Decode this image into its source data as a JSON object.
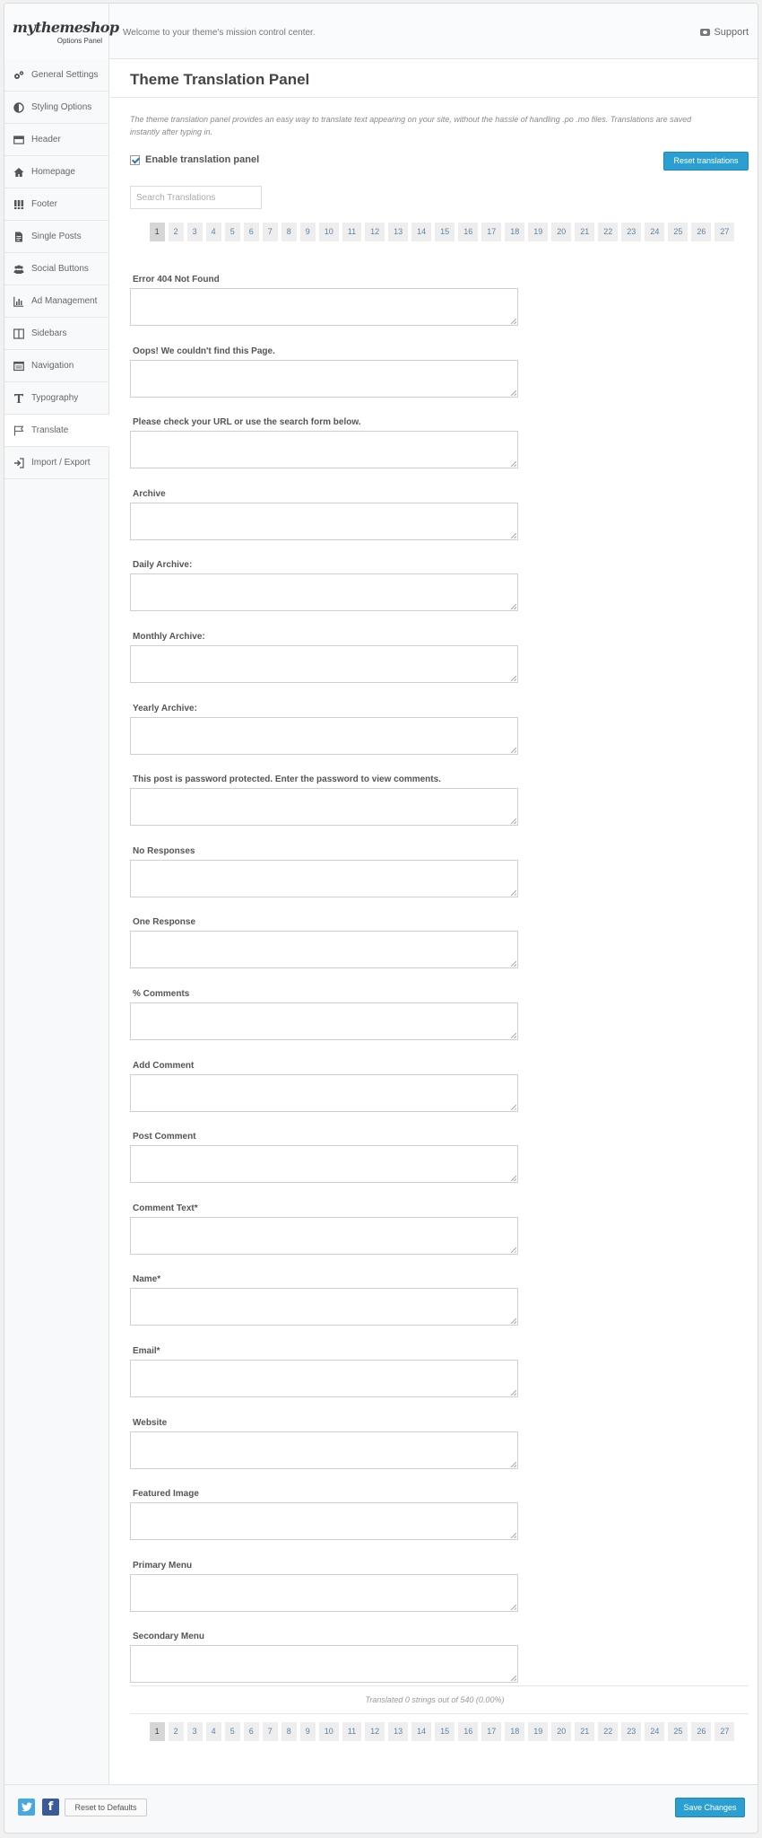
{
  "header": {
    "logo": "mythemeshop",
    "logo_sub": "Options Panel",
    "welcome": "Welcome to your theme's mission control center.",
    "support": "Support"
  },
  "sidebar": {
    "items": [
      {
        "label": "General Settings",
        "icon": "gears-icon"
      },
      {
        "label": "Styling Options",
        "icon": "contrast-icon"
      },
      {
        "label": "Header",
        "icon": "header-card-icon"
      },
      {
        "label": "Homepage",
        "icon": "home-icon"
      },
      {
        "label": "Footer",
        "icon": "footer-columns-icon"
      },
      {
        "label": "Single Posts",
        "icon": "document-icon"
      },
      {
        "label": "Social Buttons",
        "icon": "users-icon"
      },
      {
        "label": "Ad Management",
        "icon": "bar-chart-icon"
      },
      {
        "label": "Sidebars",
        "icon": "sidebars-icon"
      },
      {
        "label": "Navigation",
        "icon": "navigation-list-icon"
      },
      {
        "label": "Typography",
        "icon": "text-type-icon"
      },
      {
        "label": "Translate",
        "icon": "flag-icon"
      },
      {
        "label": "Import / Export",
        "icon": "sign-in-icon"
      }
    ],
    "active_index": 11
  },
  "main": {
    "title": "Theme Translation Panel",
    "description": "The theme translation panel provides an easy way to translate text appearing on your site, without the hassle of handling .po .mo files. Translations are saved instantly after typing in.",
    "enable_label": "Enable translation panel",
    "enable_checked": true,
    "reset_translations": "Reset translations",
    "search_placeholder": "Search Translations",
    "pages": [
      "1",
      "2",
      "3",
      "4",
      "5",
      "6",
      "7",
      "8",
      "9",
      "10",
      "11",
      "12",
      "13",
      "14",
      "15",
      "16",
      "17",
      "18",
      "19",
      "20",
      "21",
      "22",
      "23",
      "24",
      "25",
      "26",
      "27"
    ],
    "current_page": "1",
    "fields": [
      "Error 404 Not Found",
      "Oops! We couldn't find this Page.",
      "Please check your URL or use the search form below.",
      "Archive",
      "Daily Archive:",
      "Monthly Archive:",
      "Yearly Archive:",
      "This post is password protected. Enter the password to view comments.",
      "No Responses",
      "One Response",
      "% Comments",
      "Add Comment",
      "Post Comment",
      "Comment Text*",
      "Name*",
      "Email*",
      "Website",
      "Featured Image",
      "Primary Menu",
      "Secondary Menu"
    ],
    "translated_status": "Translated 0 strings out of 540 (0.00%)"
  },
  "footer": {
    "twitter": "twitter-icon",
    "facebook": "facebook-icon",
    "reset_defaults": "Reset to Defaults",
    "save": "Save Changes"
  },
  "colors": {
    "accent": "#2b9fd1",
    "twitter": "#4aa8e0",
    "facebook": "#3b5a9b"
  }
}
